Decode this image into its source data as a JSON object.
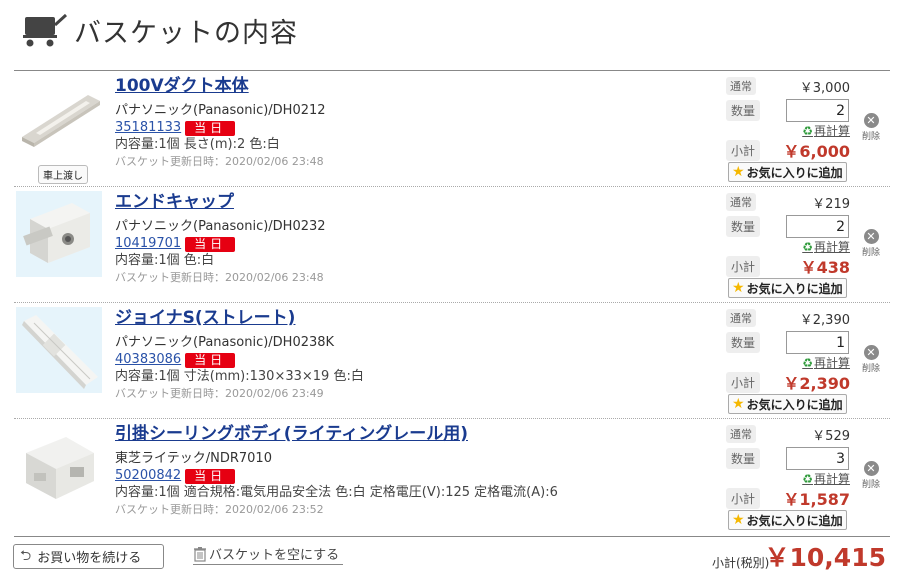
{
  "page": {
    "title": "バスケットの内容"
  },
  "labels": {
    "normal": "通常",
    "quantity": "数量",
    "recalc": "再計算",
    "subtotal": "小計",
    "favorite": "お気に入りに追加",
    "delete": "削除",
    "today": "当日",
    "truck": "車上渡し"
  },
  "items": [
    {
      "name": "100Vダクト本体",
      "maker": "パナソニック(Panasonic)/DH0212",
      "code": "35181133",
      "spec": "内容量:1個 長さ(m):2 色:白",
      "updated": "バスケット更新日時：2020/02/06 23:48",
      "normal_price": "￥3,000",
      "quantity": "2",
      "subtotal": "￥6,000"
    },
    {
      "name": "エンドキャップ",
      "maker": "パナソニック(Panasonic)/DH0232",
      "code": "10419701",
      "spec": "内容量:1個 色:白",
      "updated": "バスケット更新日時：2020/02/06 23:48",
      "normal_price": "￥219",
      "quantity": "2",
      "subtotal": "￥438"
    },
    {
      "name": "ジョイナS(ストレート)",
      "maker": "パナソニック(Panasonic)/DH0238K",
      "code": "40383086",
      "spec": "内容量:1個 寸法(mm):130×33×19 色:白",
      "updated": "バスケット更新日時：2020/02/06 23:49",
      "normal_price": "￥2,390",
      "quantity": "1",
      "subtotal": "￥2,390"
    },
    {
      "name": "引掛シーリングボディ(ライティングレール用)",
      "maker": "東芝ライテック/NDR7010",
      "code": "50200842",
      "spec": "内容量:1個 適合規格:電気用品安全法 色:白 定格電圧(V):125 定格電流(A):6",
      "updated": "バスケット更新日時：2020/02/06 23:52",
      "normal_price": "￥529",
      "quantity": "3",
      "subtotal": "￥1,587"
    }
  ],
  "footer": {
    "continue_label": "お買い物を続ける",
    "empty_label": "バスケットを空にする",
    "total_label": "小計(税別)",
    "total_value": "￥10,415"
  },
  "colors": {
    "price_red": "#c0392b",
    "link_blue": "#1a3b8f",
    "today_badge": "#e60012"
  }
}
